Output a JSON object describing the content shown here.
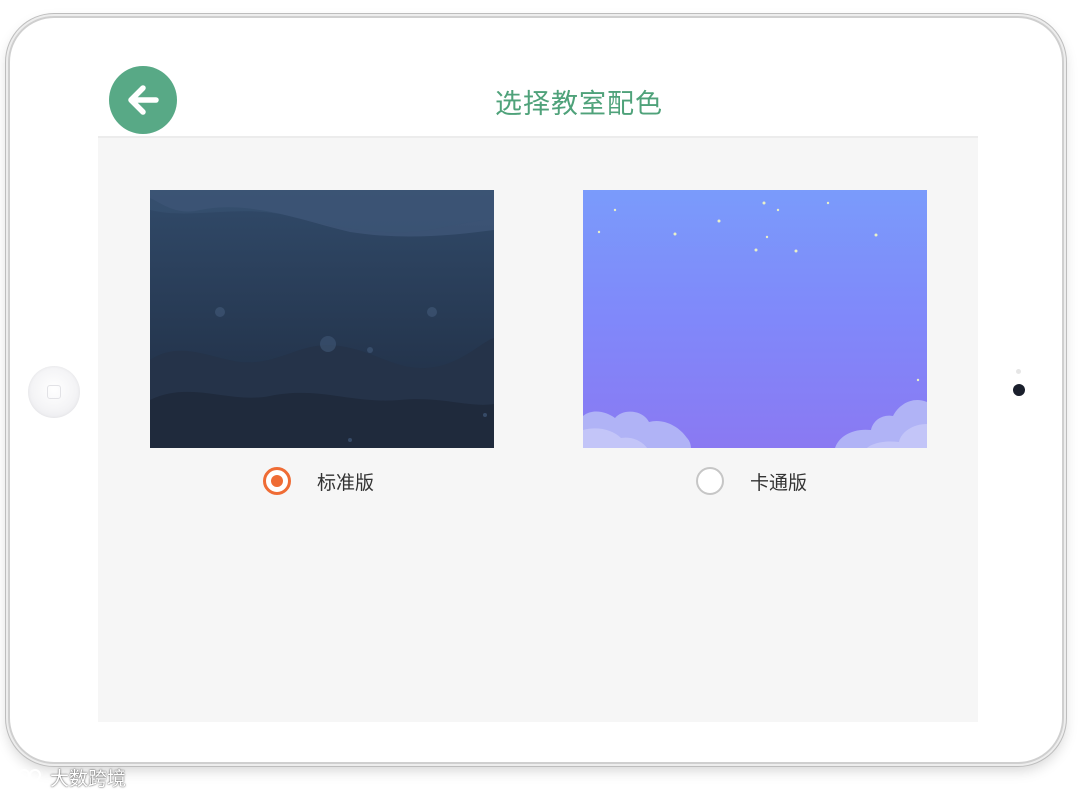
{
  "page": {
    "title": "选择教室配色",
    "back_icon": "arrow-left-icon"
  },
  "themes": [
    {
      "id": "standard",
      "label": "标准版",
      "selected": true
    },
    {
      "id": "cartoon",
      "label": "卡通版",
      "selected": false
    }
  ],
  "colors": {
    "accent": "#58a986",
    "title": "#4fa27a",
    "radio_selected": "#ef6c35",
    "radio_unselected": "#c6c6c6",
    "content_bg": "#f6f6f6"
  },
  "watermark": {
    "text": "大数跨境"
  }
}
